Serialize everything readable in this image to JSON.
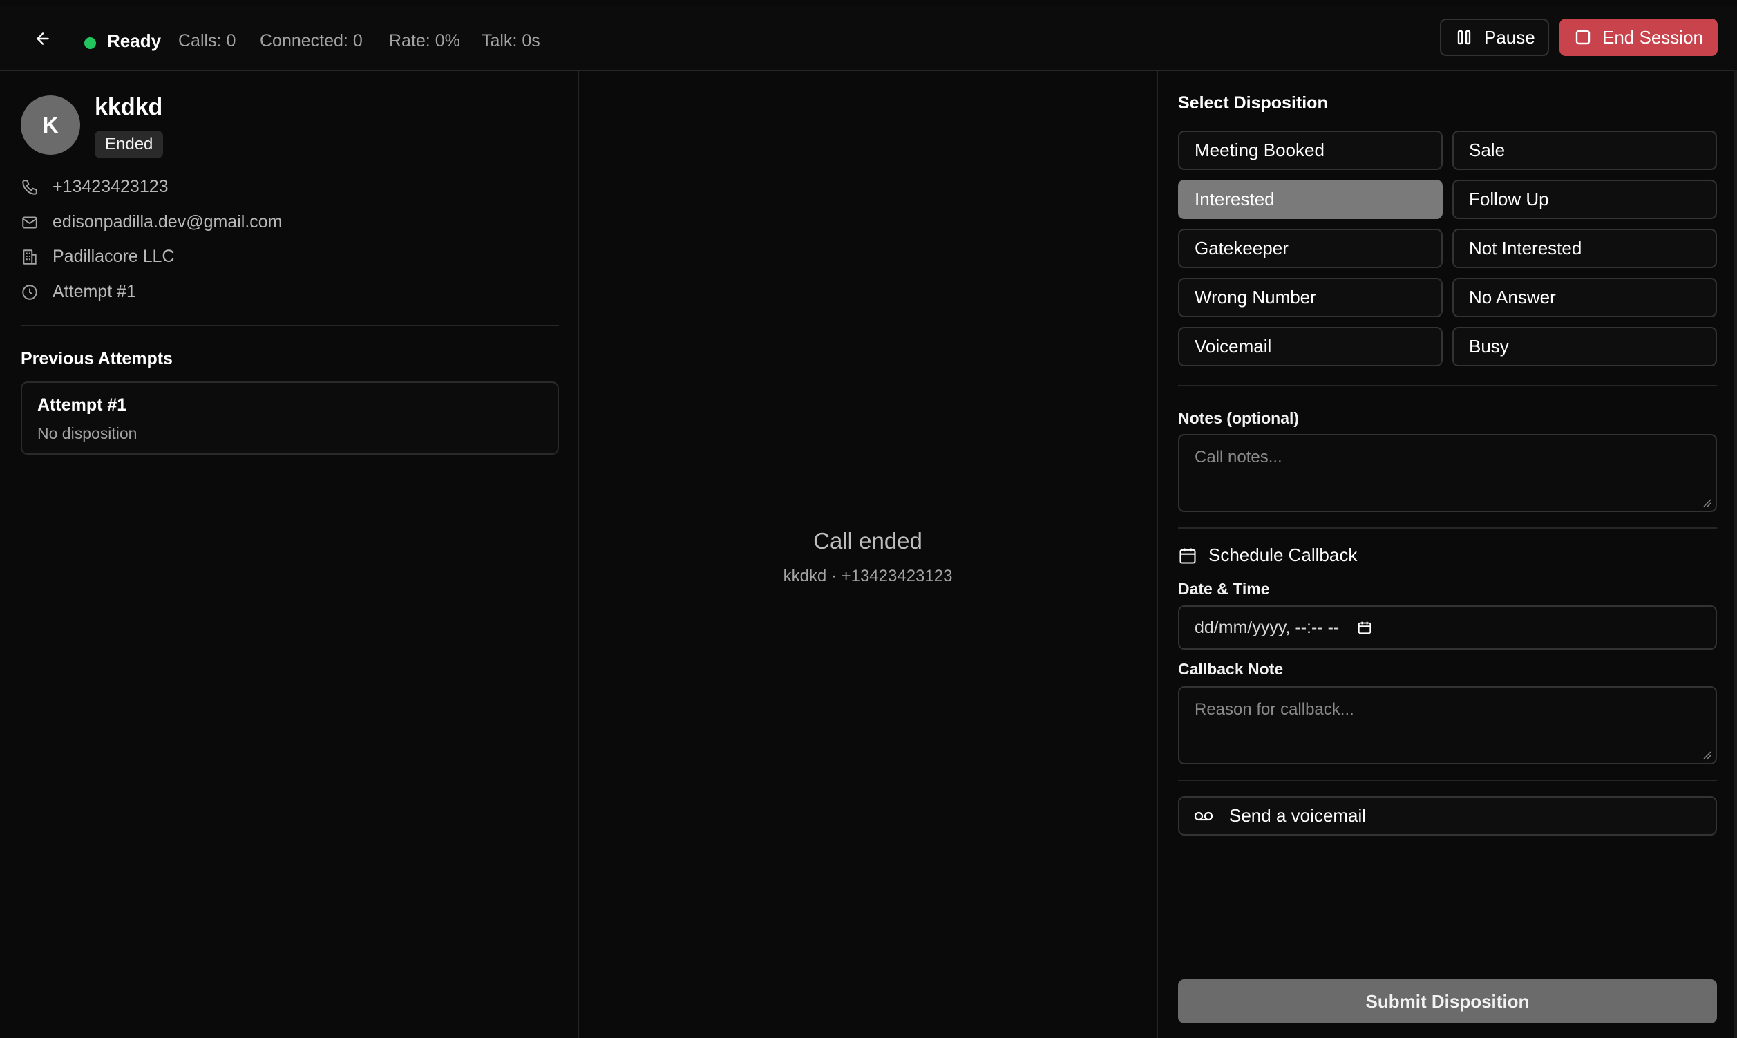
{
  "topbar": {
    "status": "Ready",
    "calls": "Calls: 0",
    "connected": "Connected: 0",
    "rate": "Rate: 0%",
    "talk": "Talk: 0s",
    "pause_label": "Pause",
    "end_session_label": "End Session",
    "status_color": "#22c55e",
    "end_color": "#c9434d"
  },
  "contact": {
    "initial": "K",
    "name": "kkdkd",
    "badge": "Ended",
    "phone": "+13423423123",
    "email": "edisonpadilla.dev@gmail.com",
    "company": "Padillacore LLC",
    "attempt": "Attempt #1"
  },
  "previous_attempts": {
    "title": "Previous Attempts",
    "items": [
      {
        "title": "Attempt #1",
        "subtitle": "No disposition"
      }
    ]
  },
  "call_panel": {
    "title": "Call ended",
    "subtitle": "kkdkd · +13423423123"
  },
  "disposition": {
    "title": "Select Disposition",
    "selected": "Interested",
    "options": [
      "Meeting Booked",
      "Sale",
      "Interested",
      "Follow Up",
      "Gatekeeper",
      "Not Interested",
      "Wrong Number",
      "No Answer",
      "Voicemail",
      "Busy"
    ]
  },
  "notes": {
    "label": "Notes (optional)",
    "placeholder": "Call notes..."
  },
  "callback": {
    "title": "Schedule Callback",
    "date_label": "Date & Time",
    "date_value": "dd/mm/yyyy, --:-- --",
    "note_label": "Callback Note",
    "note_placeholder": "Reason for callback..."
  },
  "voicemail_label": "Send a voicemail",
  "submit_label": "Submit Disposition",
  "icons": [
    "arrow-left-icon",
    "pause-icon",
    "stop-square-icon",
    "phone-icon",
    "mail-icon",
    "building-icon",
    "clock-icon",
    "calendar-icon",
    "voicemail-icon"
  ]
}
